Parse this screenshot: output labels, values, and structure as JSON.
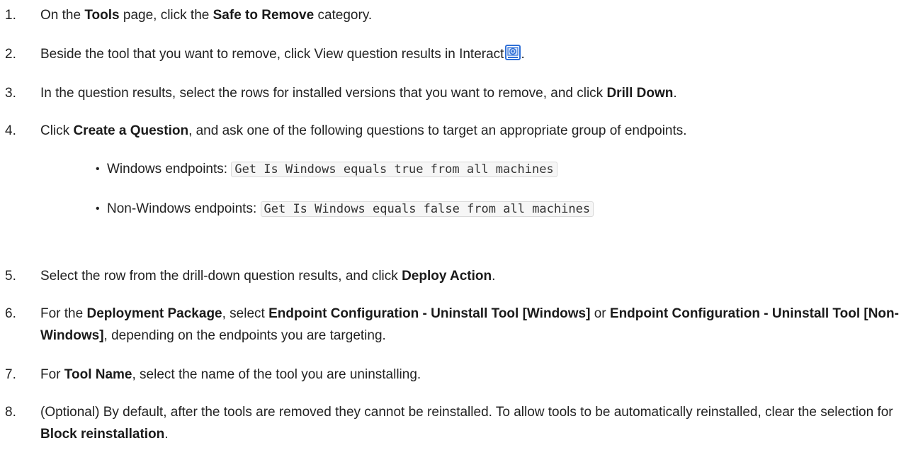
{
  "steps": [
    {
      "num": "1.",
      "parts": [
        "On the ",
        "Tools",
        " page, click the ",
        "Safe to Remove",
        " category."
      ]
    },
    {
      "num": "2.",
      "text_before_icon": "Beside the tool that you want to remove, click View question results in Interact",
      "icon": "interact-results-icon",
      "text_after_icon": "."
    },
    {
      "num": "3.",
      "parts": [
        "In the question results, select the rows for installed versions that you want to remove, and click ",
        "Drill Down",
        "."
      ]
    },
    {
      "num": "4.",
      "parts": [
        "Click ",
        "Create a Question",
        ", and ask one of the following questions to target an appropriate group of endpoints."
      ]
    },
    {
      "num": "5.",
      "parts": [
        "Select the row from the drill-down question results, and click ",
        "Deploy Action",
        "."
      ]
    },
    {
      "num": "6.",
      "parts": [
        "For the ",
        "Deployment Package",
        ", select ",
        "Endpoint Configuration - Uninstall Tool [Windows]",
        " or ",
        "Endpoint Configuration - Uninstall Tool [Non-Windows]",
        ", depending on the endpoints you are targeting."
      ]
    },
    {
      "num": "7.",
      "parts": [
        "For ",
        "Tool Name",
        ", select the name of the tool you are uninstalling."
      ]
    },
    {
      "num": "8.",
      "parts": [
        "(Optional) By default, after the tools are removed they cannot be reinstalled. To allow tools to be automatically reinstalled, clear the selection for ",
        "Block reinstallation",
        "."
      ]
    }
  ],
  "bullets": [
    {
      "label": "Windows endpoints: ",
      "code": "Get Is Windows equals true from all machines"
    },
    {
      "label": "Non-Windows endpoints: ",
      "code": "Get Is Windows equals false from all machines"
    }
  ],
  "bullet_glyph": "•",
  "colors": {
    "text": "#222222",
    "icon_blue": "#2f6fd6",
    "code_bg": "#f6f6f6",
    "code_border": "#d8d8d8"
  }
}
